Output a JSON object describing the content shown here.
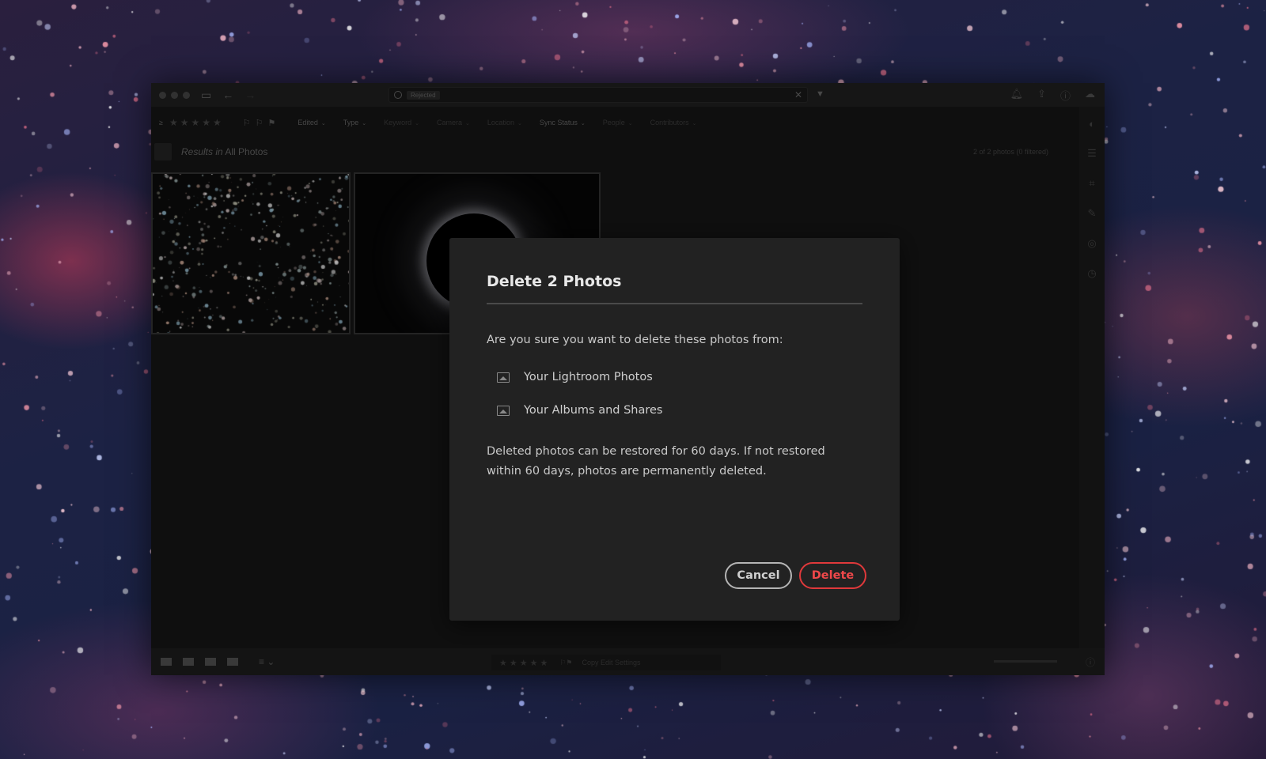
{
  "app": {
    "search_chip": "Rejected",
    "filter_bar": {
      "sort_icon": "sort-icon",
      "items": [
        {
          "label": "Edited",
          "enabled": true
        },
        {
          "label": "Type",
          "enabled": true
        },
        {
          "label": "Keyword",
          "enabled": false
        },
        {
          "label": "Camera",
          "enabled": false
        },
        {
          "label": "Location",
          "enabled": false
        },
        {
          "label": "Sync Status",
          "enabled": true
        },
        {
          "label": "People",
          "enabled": false
        },
        {
          "label": "Contributors",
          "enabled": false
        }
      ]
    },
    "results": {
      "prefix": "Results in",
      "scope": "All Photos",
      "count": "2 of 2 photos (0 filtered)"
    },
    "bottom_bar": {
      "copy_settings": "Copy Edit Settings"
    }
  },
  "dialog": {
    "title": "Delete 2 Photos",
    "question": "Are you sure you want to delete these photos from:",
    "locations": [
      {
        "icon": "image-icon",
        "label": "Your Lightroom Photos"
      },
      {
        "icon": "image-icon",
        "label": "Your Albums and Shares"
      }
    ],
    "note": "Deleted photos can be restored for 60 days. If not restored within 60 days, photos are permanently deleted.",
    "cancel_label": "Cancel",
    "delete_label": "Delete"
  },
  "colors": {
    "dialog_bg": "#222222",
    "delete_accent": "#e0393b",
    "app_bg": "#121212"
  }
}
